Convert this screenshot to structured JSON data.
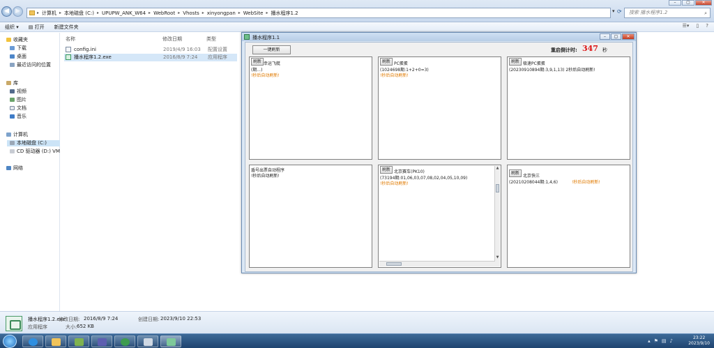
{
  "explorer": {
    "breadcrumbs": [
      "计算机",
      "本地磁盘 (C:)",
      "UPUPW_ANK_W64",
      "WebRoot",
      "Vhosts",
      "xinyongpan",
      "WebSite",
      "播水程序1.2"
    ],
    "search_placeholder": "搜索 播水程序1.2",
    "toolbar": {
      "organize": "组织 ▾",
      "open": "打开",
      "new_folder": "新建文件夹"
    },
    "nav": {
      "favorites": "收藏夹",
      "downloads": "下载",
      "desktop": "桌面",
      "recent": "最近访问的位置",
      "libraries": "库",
      "videos": "视频",
      "pictures": "图片",
      "documents": "文档",
      "music": "音乐",
      "computer": "计算机",
      "local_disk": "本地磁盘 (C:)",
      "cd_drive": "CD 驱动器 (D:) VM",
      "network": "网络"
    },
    "columns": {
      "name": "名称",
      "modified": "修改日期",
      "type": "类型"
    },
    "files": [
      {
        "name": "config.ini",
        "modified": "2019/4/9 16:03",
        "type": "配置设置"
      },
      {
        "name": "播水程序1.2.exe",
        "modified": "2016/8/9 7:24",
        "type": "应用程序"
      }
    ],
    "details": {
      "filename": "播水程序1.2.exe",
      "modified_label": "修改日期:",
      "modified": "2016/8/9 7:24",
      "created_label": "创建日期:",
      "created": "2023/9/10 22:53",
      "type": "应用程序",
      "size_label": "大小:",
      "size": "652 KB"
    }
  },
  "app": {
    "title": "播水程序1.1",
    "refresh_all": "一键刷新",
    "countdown_label": "重启倒计时:",
    "countdown_value": "347",
    "countdown_unit": "秒",
    "panels": [
      {
        "button": "刷新",
        "name": "幸运飞艇",
        "lines": [
          "(期...)"
        ],
        "status": "!秒后自动刷新!"
      },
      {
        "button": "刷新",
        "name": "PC蛋蛋",
        "lines": [
          "(1024698期:1+2+0=3)"
        ],
        "status": "!秒后自动刷新!"
      },
      {
        "button": "刷新",
        "name": "极速PC蛋蛋",
        "lines": [
          "(20230910894期:3,9,1,13) 2秒后自动刷新!"
        ],
        "status": ""
      },
      {
        "button": "",
        "name": "",
        "lines": [
          "盾号出票自动程序"
        ],
        "status": "!秒后自动刷新!"
      },
      {
        "button": "刷新",
        "name": "北京赛车(PK10)",
        "lines": [
          "(73194期:01,06,03,07,08,02,04,05,10,09)"
        ],
        "status": "!秒后自动刷新!"
      },
      {
        "button": "刷新",
        "name": "北京快三",
        "lines": [
          "(20210208044期:1,4,6)"
        ],
        "status": "!秒后自动刷新!"
      }
    ]
  },
  "taskbar": {
    "time": "23:22",
    "date": "2023/9/10"
  }
}
